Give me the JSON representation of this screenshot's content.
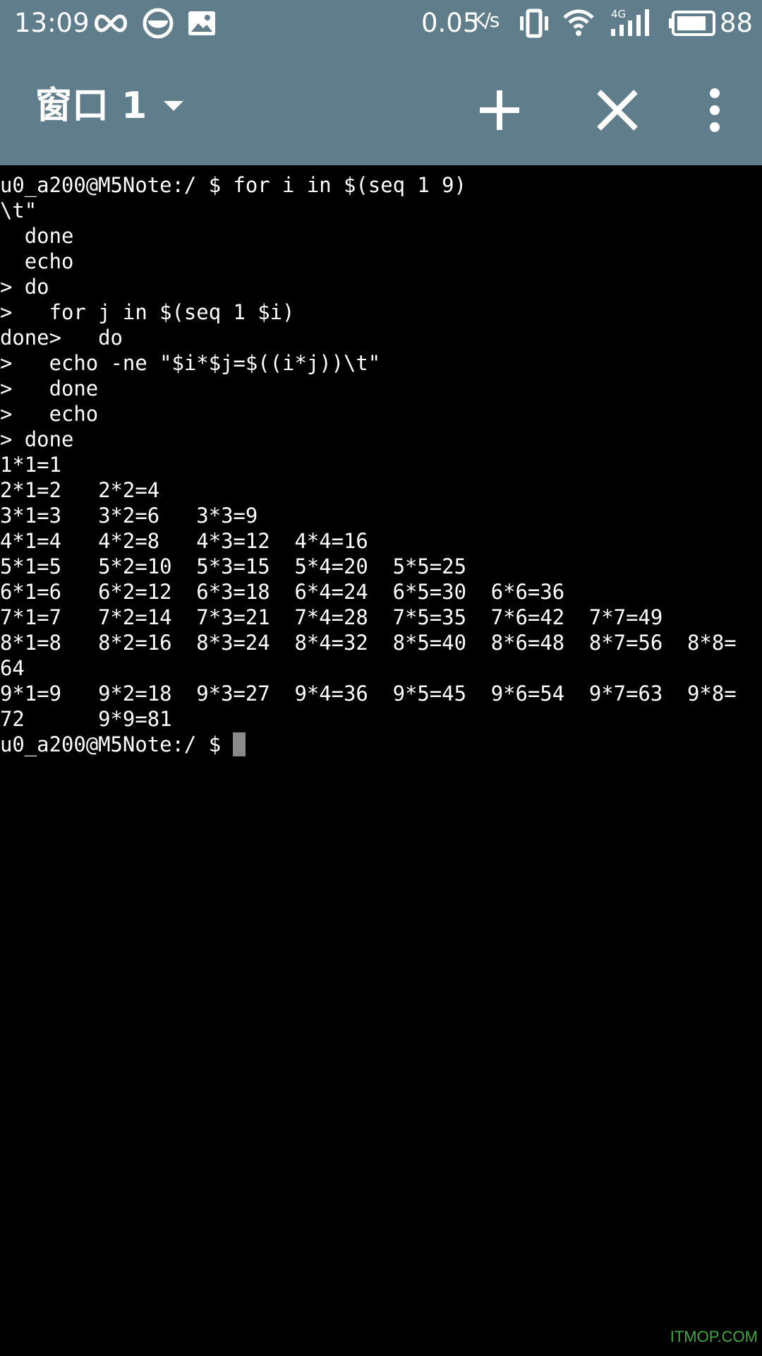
{
  "status_bar": {
    "time": "13:09",
    "left_icons": [
      "infinity-icon",
      "smiley-icon",
      "gallery-icon"
    ],
    "network_speed": "0.05",
    "network_speed_unit": "K/s",
    "right_icons": [
      "vibrate-icon",
      "wifi-icon",
      "signal-4g-icon",
      "battery-icon"
    ],
    "network_type": "4G",
    "battery_level": 88,
    "battery_text": "88"
  },
  "toolbar": {
    "window_title": "窗口 1",
    "title_dropdown_icon": "caret-down-icon",
    "new_window_icon": "plus-icon",
    "close_window_icon": "close-icon",
    "more_icon": "more-vert-icon"
  },
  "terminal": {
    "lines": [
      "u0_a200@M5Note:/ $ for i in $(seq 1 9)",
      "\\t\"",
      "  done",
      "  echo",
      "> do",
      ">   for j in $(seq 1 $i)",
      "done>   do",
      ">   echo -ne \"$i*$j=$((i*j))\\t\"",
      ">   done",
      ">   echo",
      "> done",
      "1*1=1",
      "2*1=2   2*2=4",
      "3*1=3   3*2=6   3*3=9",
      "4*1=4   4*2=8   4*3=12  4*4=16",
      "5*1=5   5*2=10  5*3=15  5*4=20  5*5=25",
      "6*1=6   6*2=12  6*3=18  6*4=24  6*5=30  6*6=36",
      "7*1=7   7*2=14  7*3=21  7*4=28  7*5=35  7*6=42  7*7=49",
      "8*1=8   8*2=16  8*3=24  8*4=32  8*5=40  8*6=48  8*7=56  8*8=",
      "64",
      "9*1=9   9*2=18  9*3=27  9*4=36  9*5=45  9*6=54  9*7=63  9*8=",
      "72      9*9=81"
    ],
    "prompt": "u0_a200@M5Note:/ $ "
  },
  "watermark": "ITMOP.COM",
  "colors": {
    "bar": "#607d8b",
    "terminal_bg": "#000000",
    "terminal_fg": "#ffffff",
    "cursor": "#8a8a8a",
    "watermark": "#3da83d"
  }
}
